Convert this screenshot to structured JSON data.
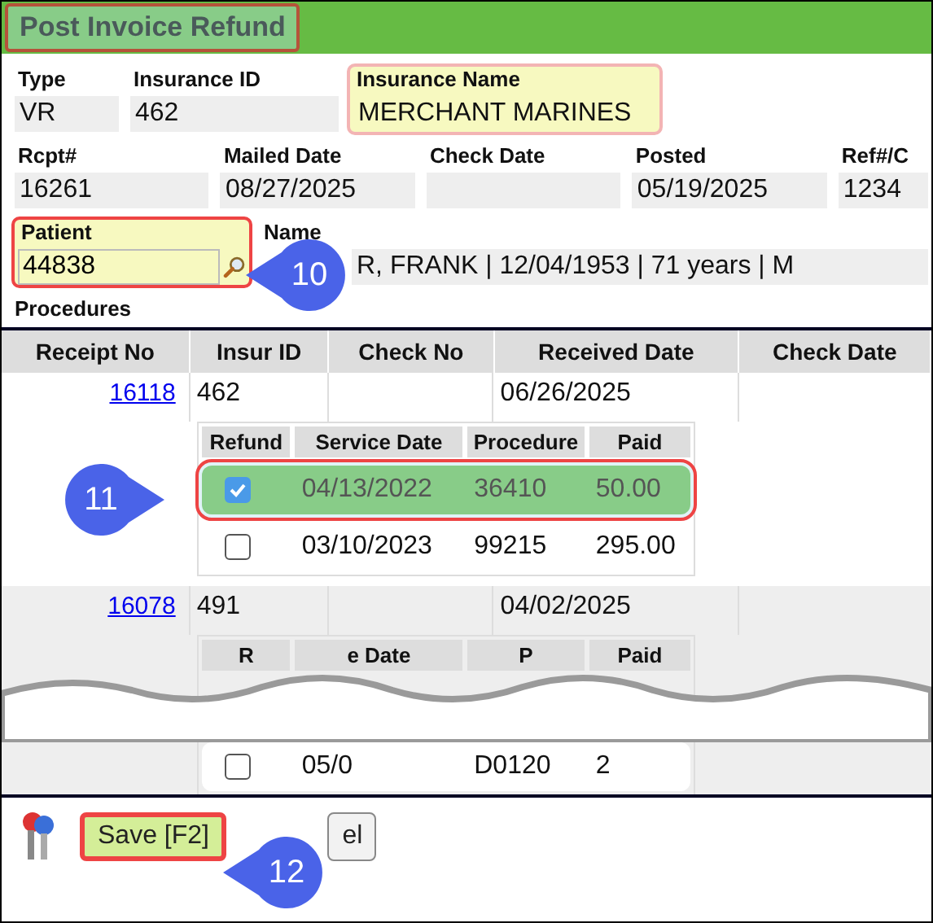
{
  "title": "Post Invoice Refund",
  "row1": [
    {
      "label": "Type",
      "value": "VR",
      "highlighted": false
    },
    {
      "label": "Insurance ID",
      "value": "462",
      "highlighted": false
    },
    {
      "label": "Insurance Name",
      "value": "MERCHANT MARINES",
      "highlighted": true
    }
  ],
  "row2": [
    {
      "label": "Rcpt#",
      "value": "16261"
    },
    {
      "label": "Mailed Date",
      "value": "08/27/2025"
    },
    {
      "label": "Check Date"
    },
    {
      "label": "Posted",
      "value": "05/19/2025"
    },
    {
      "label": "Ref#/C",
      "value": "1234"
    }
  ],
  "patient": {
    "label": "Patient",
    "value": "44838",
    "highlighted": true
  },
  "name": {
    "label": "Name",
    "value": "R, FRANK | 12/04/1953 | 71 years | M"
  },
  "procedures_label": "Procedures",
  "table": {
    "columns": [
      "Receipt No",
      "Insur ID",
      "Check No",
      "Received Date",
      "Check Date"
    ],
    "rows": [
      {
        "receipt_no": "16118",
        "insur_id": "462",
        "received_date": "06/26/2025",
        "shaded": false,
        "procedures": {
          "columns": [
            "Refund",
            "Service Date",
            "Procedure",
            "Paid"
          ],
          "rows": [
            {
              "checked": true,
              "selected": true,
              "service_date": "04/13/2022",
              "procedure": "36410",
              "paid": "50.00"
            },
            {
              "checked": false,
              "selected": false,
              "service_date": "03/10/2023",
              "procedure": "99215",
              "paid": "295.00"
            }
          ]
        }
      },
      {
        "receipt_no": "16078",
        "insur_id": "491",
        "received_date": "04/02/2025",
        "shaded": true,
        "procedures": {
          "columns": [
            "R",
            "e Date",
            "P",
            "Paid"
          ],
          "rows": [
            {
              "checked": false,
              "selected": false,
              "service_date": "05/0",
              "procedure": "D0120",
              "paid": "2"
            }
          ]
        }
      }
    ]
  },
  "buttons": [
    {
      "label": "Save [F2]",
      "highlighted": true
    },
    {
      "label": "el",
      "highlighted": false
    }
  ],
  "callouts": [
    {
      "number": "10"
    },
    {
      "number": "11"
    },
    {
      "number": "12"
    }
  ]
}
